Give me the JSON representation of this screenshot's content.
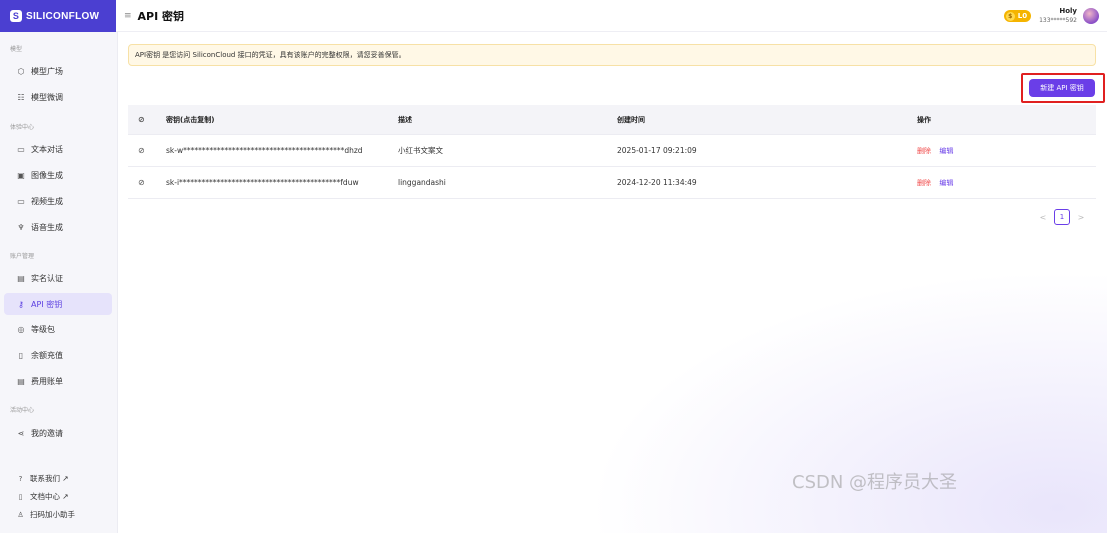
{
  "brand": {
    "name": "SILICONFLOW",
    "mark": "S"
  },
  "header": {
    "title": "API 密钥",
    "menu_icon": "≡",
    "level": "L0",
    "user_name": "Holy",
    "user_phone": "133*****592"
  },
  "sidebar": {
    "sections": [
      {
        "title": "模型"
      },
      {
        "title": "体验中心"
      },
      {
        "title": "账户管理"
      },
      {
        "title": "活动中心"
      }
    ],
    "items": [
      {
        "label": "模型广场",
        "icon": "cube-icon"
      },
      {
        "label": "模型微调",
        "icon": "sliders-icon"
      },
      {
        "label": "文本对话",
        "icon": "chat-icon"
      },
      {
        "label": "图像生成",
        "icon": "image-icon"
      },
      {
        "label": "视频生成",
        "icon": "video-icon"
      },
      {
        "label": "语音生成",
        "icon": "mic-icon"
      },
      {
        "label": "实名认证",
        "icon": "id-card-icon"
      },
      {
        "label": "API 密钥",
        "icon": "key-icon"
      },
      {
        "label": "等级包",
        "icon": "package-icon"
      },
      {
        "label": "余额充值",
        "icon": "wallet-icon"
      },
      {
        "label": "费用账单",
        "icon": "bill-icon"
      },
      {
        "label": "我的邀请",
        "icon": "share-icon"
      }
    ],
    "footer": [
      {
        "label": "联系我们 ↗",
        "icon": "help-icon"
      },
      {
        "label": "文档中心 ↗",
        "icon": "doc-icon"
      },
      {
        "label": "扫码加小助手",
        "icon": "user-icon"
      }
    ]
  },
  "notice": "API密钥 是您访问 SiliconCloud 接口的凭证，具有该账户的完整权限，请您妥善保管。",
  "new_button": "新建 API 密钥",
  "table": {
    "headers": [
      "密钥(点击复制)",
      "描述",
      "创建时间",
      "操作"
    ],
    "rows": [
      {
        "key": "sk-w*******************************************dhzd",
        "desc": "小红书文案文",
        "created": "2025-01-17 09:21:09",
        "delete": "删除",
        "edit": "编辑"
      },
      {
        "key": "sk-i*******************************************fduw",
        "desc": "linggandashi",
        "created": "2024-12-20 11:34:49",
        "delete": "删除",
        "edit": "编辑"
      }
    ]
  },
  "pagination": {
    "current": "1",
    "prev": "<",
    "next": ">"
  },
  "watermark": "CSDN @程序员大圣"
}
